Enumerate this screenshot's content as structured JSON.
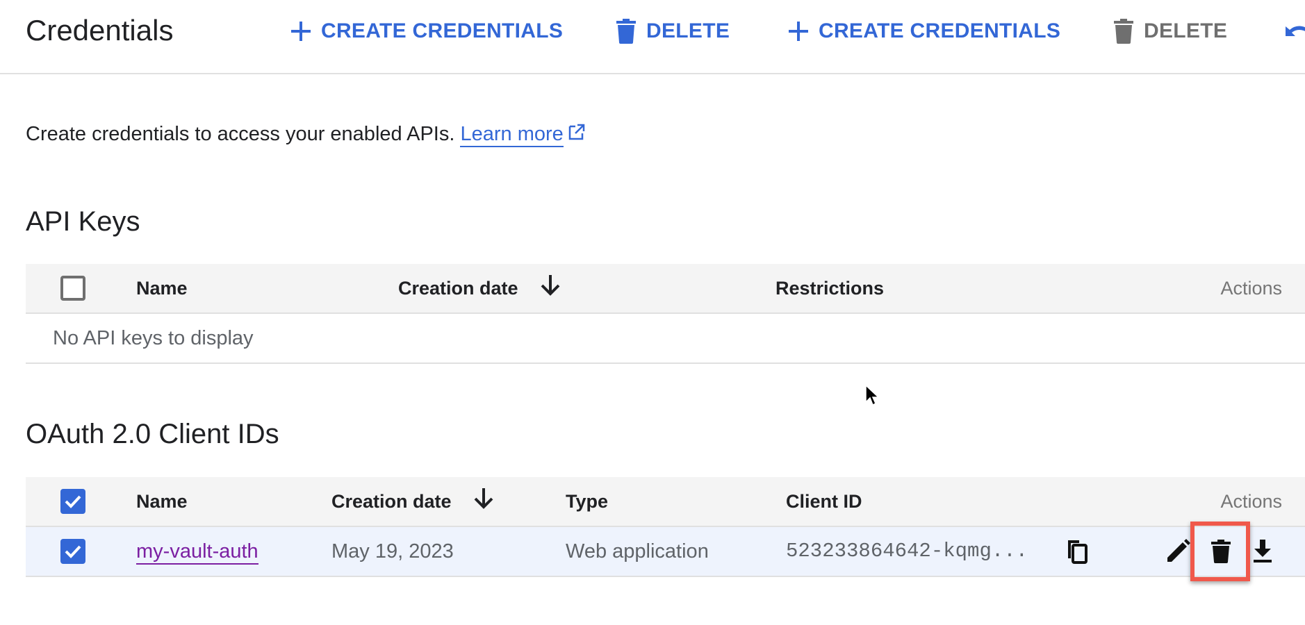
{
  "header": {
    "title": "Credentials",
    "buttons": [
      {
        "label": "CREATE CREDENTIALS",
        "icon": "plus-icon",
        "color": "#3367d6",
        "enabled": true
      },
      {
        "label": "DELETE",
        "icon": "trash-icon",
        "color": "#3367d6",
        "enabled": true
      },
      {
        "label": "CREATE CREDENTIALS",
        "icon": "plus-icon",
        "color": "#3367d6",
        "enabled": true
      },
      {
        "label": "DELETE",
        "icon": "trash-icon",
        "color": "#6f6f6f",
        "enabled": false
      }
    ],
    "undo_icon": "undo-icon"
  },
  "description": {
    "text": "Create credentials to access your enabled APIs.",
    "link_label": "Learn more",
    "link_icon": "external-link-icon"
  },
  "api_keys": {
    "heading": "API Keys",
    "columns": [
      "Name",
      "Creation date",
      "Restrictions",
      "Actions"
    ],
    "sort_column": "Creation date",
    "sort_direction": "descending",
    "select_all_checked": false,
    "empty_message": "No API keys to display"
  },
  "oauth": {
    "heading": "OAuth 2.0 Client IDs",
    "columns": [
      "Name",
      "Creation date",
      "Type",
      "Client ID",
      "Actions"
    ],
    "sort_column": "Creation date",
    "sort_direction": "descending",
    "select_all_checked": true,
    "rows": [
      {
        "checked": true,
        "name": "my-vault-auth",
        "creation_date": "May 19, 2023",
        "type": "Web application",
        "client_id": "523233864642-kqmg...",
        "actions": [
          "edit-icon",
          "delete-icon",
          "download-icon"
        ],
        "highlighted_action": "delete-icon"
      }
    ]
  },
  "colors": {
    "accent": "#3367d6",
    "disabled": "#6f6f6f",
    "link_visited": "#7b1fa2",
    "selected_row": "#eef3fd",
    "header_bg": "#f4f4f4",
    "highlight": "#f0584b"
  }
}
